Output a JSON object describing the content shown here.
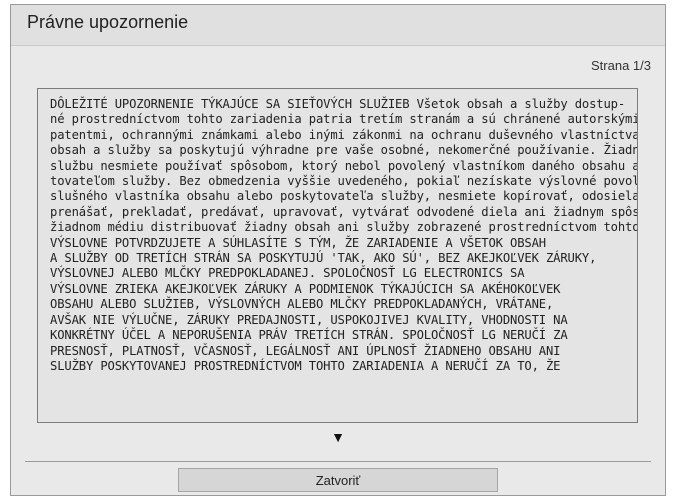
{
  "dialog": {
    "title": "Právne upozornenie",
    "page_indicator": "Strana 1/3",
    "scroll_down_glyph": "▼",
    "close_label": "Zatvoriť",
    "body_lines": [
      "DÔLEŽITÉ UPOZORNENIE TÝKAJÚCE SA SIEŤOVÝCH SLUŽIEB Všetok obsah a služby dostup-",
      "né prostredníctvom tohto zariadenia patria tretím stranám a sú chránené autorskými právami,",
      "patentmi, ochrannými známkami alebo inými zákonmi na ochranu duševného vlastníctva. Takýto",
      "obsah a služby sa poskytujú výhradne pre vaše osobné, nekomerčné používanie. Žiadny obsah ani",
      "službu nesmiete používať spôsobom, ktorý nebol povolený vlastníkom daného obsahu alebo posky-",
      "tovateľom služby. Bez obmedzenia vyššie uvedeného, pokiaľ nezískate výslovné povolenie od prí-",
      "slušného vlastníka obsahu alebo poskytovateľa služby, nesmiete kopírovať, odosielať, zverejňovať,",
      "prenášať, prekladať, predávať, upravovať, vytvárať odvodené diela ani žiadnym spôsobom ani na",
      "žiadnom médiu distribuovať žiadny obsah ani služby zobrazené prostredníctvom tohto zariadenia.",
      "VÝSLOVNE POTVRDZUJETE A SÚHLASÍTE S TÝM, ŽE ZARIADENIE A VŠETOK OBSAH",
      "A SLUŽBY OD TRETÍCH STRÁN SA POSKYTUJÚ 'TAK, AKO SÚ', BEZ AKEJKOĽVEK ZÁRUKY,",
      "VÝSLOVNEJ ALEBO MLČKY PREDPOKLADANEJ. SPOLOČNOSŤ LG ELECTRONICS SA",
      "VÝSLOVNE ZRIEKA AKEJKOĽVEK ZÁRUKY A PODMIENOK TÝKAJÚCICH SA AKÉHOKOĽVEK",
      "OBSAHU ALEBO SLUŽIEB, VÝSLOVNÝCH ALEBO MLČKY PREDPOKLADANÝCH, VRÁTANE,",
      "AVŠAK NIE VÝLUČNE, ZÁRUKY PREDAJNOSTI, USPOKOJIVEJ KVALITY, VHODNOSTI NA",
      "KONKRÉTNY ÚČEL A NEPORUŠENIA PRÁV TRETÍCH STRÁN. SPOLOČNOSŤ LG NERUČÍ ZA",
      "PRESNOSŤ, PLATNOSŤ, VČASNOSŤ, LEGÁLNOSŤ ANI ÚPLNOSŤ ŽIADNEHO OBSAHU ANI",
      "SLUŽBY POSKYTOVANEJ PROSTREDNÍCTVOM TOHTO ZARIADENIA A NERUČÍ ZA TO, ŽE"
    ]
  }
}
